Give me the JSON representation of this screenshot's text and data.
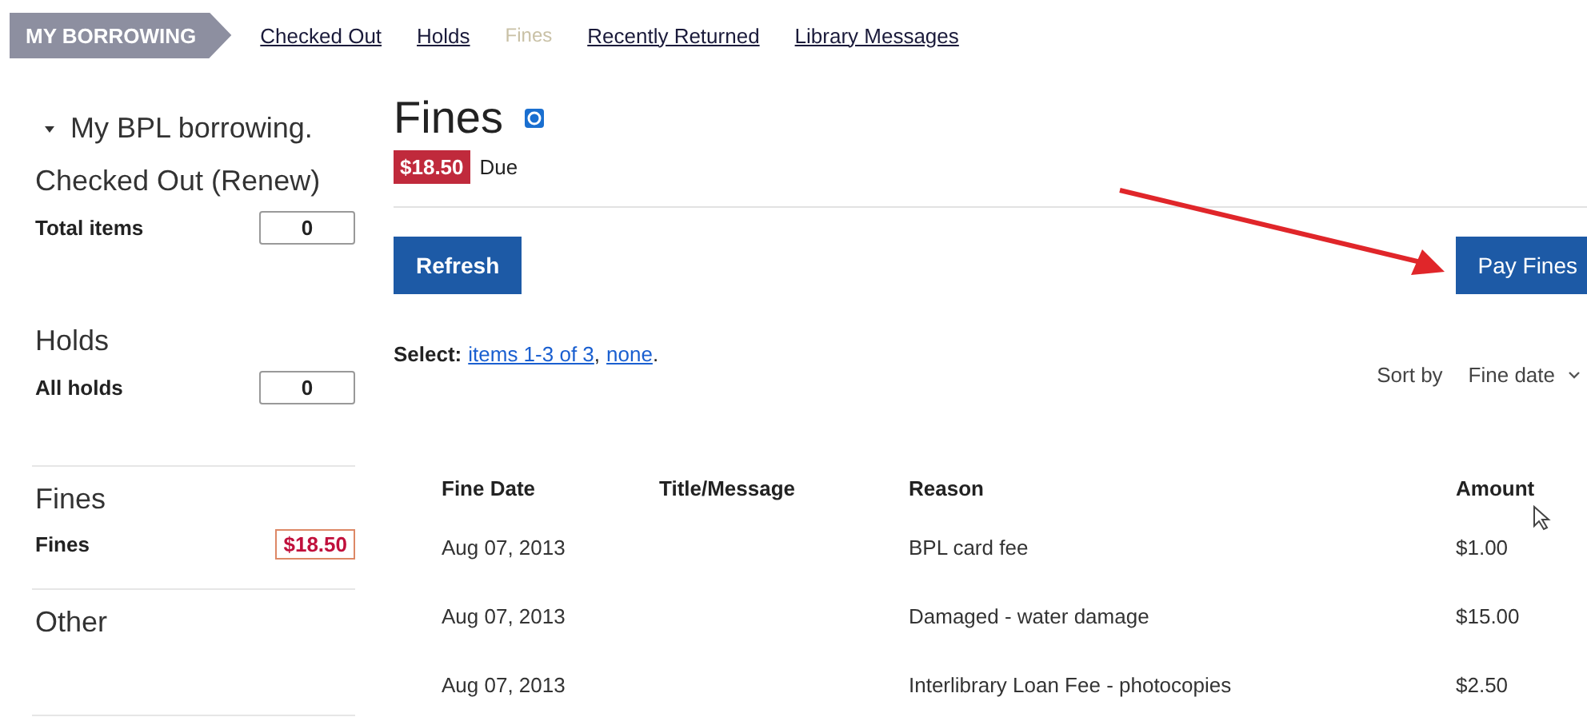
{
  "nav": {
    "title": "MY BORROWING",
    "tabs": [
      {
        "label": "Checked Out",
        "selected": false
      },
      {
        "label": "Holds",
        "selected": false
      },
      {
        "label": "Fines",
        "selected": true
      },
      {
        "label": "Recently Returned",
        "selected": false
      },
      {
        "label": "Library Messages",
        "selected": false
      }
    ]
  },
  "sidebar": {
    "heading": "My BPL borrowing.",
    "sections": [
      {
        "title": "Checked Out (Renew)",
        "label": "Total items",
        "value": "0",
        "kind": "count"
      },
      {
        "title": "Holds",
        "label": "All holds",
        "value": "0",
        "kind": "count"
      },
      {
        "title": "Fines",
        "label": "Fines",
        "value": "$18.50",
        "kind": "fine"
      },
      {
        "title": "Other"
      }
    ]
  },
  "main": {
    "title": "Fines",
    "due_amount": "$18.50",
    "due_label": "Due",
    "refresh_button": "Refresh",
    "pay_button": "Pay Fines",
    "select": {
      "label": "Select:",
      "links": [
        {
          "text": "items 1-3 of 3",
          "after": ","
        },
        {
          "text": "none",
          "after": "."
        }
      ]
    },
    "sort": {
      "label": "Sort by",
      "value": "Fine date"
    },
    "table": {
      "columns": [
        "Fine Date",
        "Title/Message",
        "Reason",
        "Amount"
      ],
      "rows": [
        [
          "Aug 07, 2013",
          "",
          "BPL card fee",
          "$1.00"
        ],
        [
          "Aug 07, 2013",
          "",
          "Damaged - water damage",
          "$15.00"
        ],
        [
          "Aug 07, 2013",
          "",
          "Interlibrary Loan Fee - photocopies",
          "$2.50"
        ]
      ]
    }
  }
}
